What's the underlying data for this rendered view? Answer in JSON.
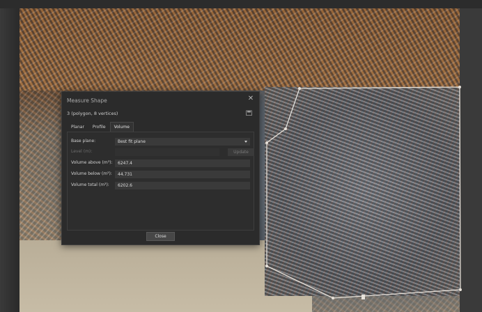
{
  "dialog": {
    "title": "Measure Shape",
    "close_icon": "close-icon",
    "subtitle": "3 (polygon, 8 vertices)",
    "save_icon": "save-icon",
    "tabs": [
      {
        "label": "Planar",
        "active": false
      },
      {
        "label": "Profile",
        "active": false
      },
      {
        "label": "Volume",
        "active": true
      }
    ],
    "base_plane": {
      "label": "Base plane:",
      "value": "Best fit plane"
    },
    "level": {
      "label": "Level (m):",
      "value": "",
      "update_label": "Update"
    },
    "volume_above": {
      "label": "Volume above (m³):",
      "value": "6247.4"
    },
    "volume_below": {
      "label": "Volume below (m³):",
      "value": "44.731"
    },
    "volume_total": {
      "label": "Volume total (m³):",
      "value": "6202.6"
    },
    "close_label": "Close"
  },
  "scene": {
    "description_icon": "aerial-orthophoto",
    "polygon_color": "#e8e2da"
  },
  "colors": {
    "dialog_bg": "#2b2b2b",
    "field_bg": "#3a3a3a",
    "text": "#d7d7d7"
  }
}
